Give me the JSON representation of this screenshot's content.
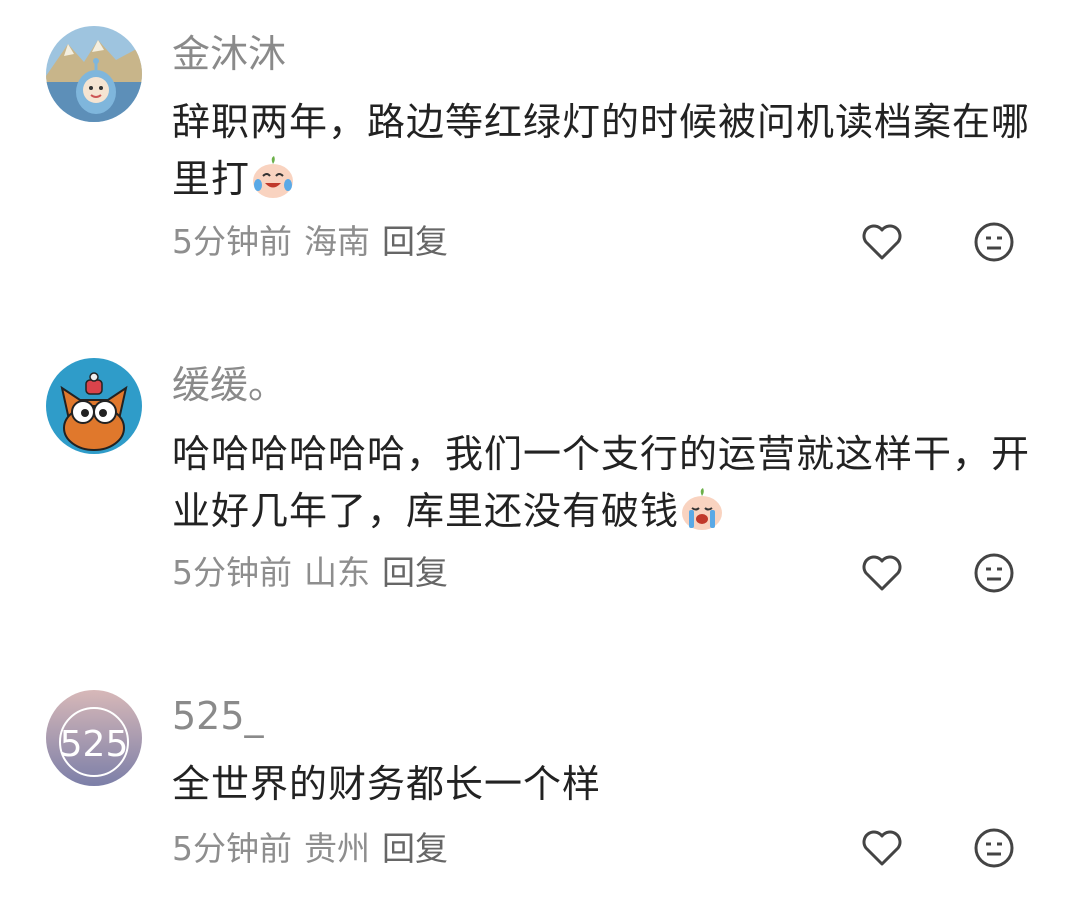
{
  "comments": [
    {
      "username": "金沐沐",
      "text": "辞职两年，路边等红绿灯的时候被问机读档案在哪里打",
      "time": "5分钟前",
      "location": "海南",
      "reply": "回复"
    },
    {
      "username": "缓缓。",
      "text": "哈哈哈哈哈哈，我们一个支行的运营就这样干，开业好几年了，库里还没有破钱",
      "time": "5分钟前",
      "location": "山东",
      "reply": "回复"
    },
    {
      "username": "525_",
      "text": "全世界的财务都长一个样",
      "time": "5分钟前",
      "location": "贵州",
      "reply": "回复"
    }
  ],
  "avatar3_text": "525",
  "colors": {
    "username": "#8a8a8a",
    "text": "#222222",
    "meta": "#8e8e8e"
  },
  "icons": [
    "like-heart-icon",
    "dislike-face-icon",
    "laughing-crying-emoji",
    "crying-emoji"
  ]
}
